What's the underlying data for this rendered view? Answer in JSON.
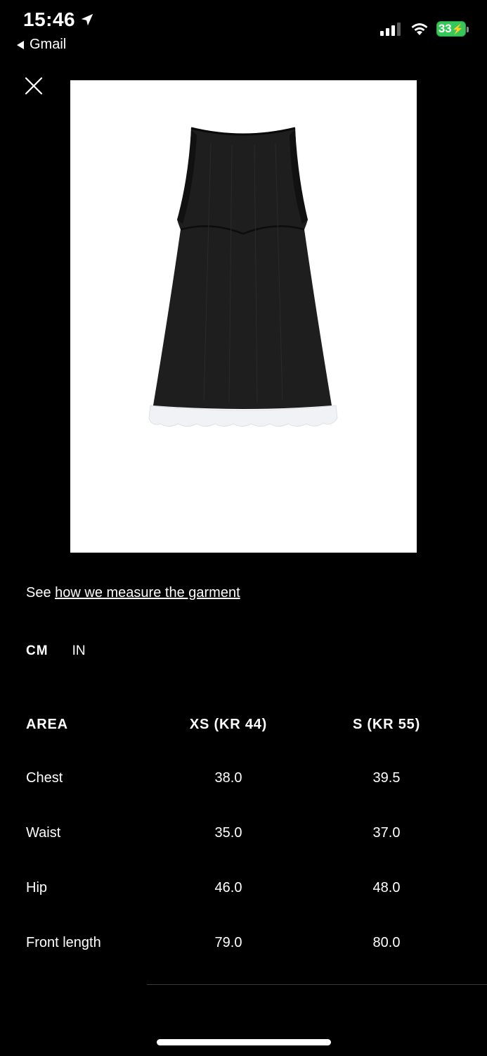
{
  "status_bar": {
    "time": "15:46",
    "back_app": "Gmail",
    "battery": "33"
  },
  "icons": {
    "location": "location-arrow-icon",
    "back": "back-triangle-icon",
    "signal": "cellular-signal-icon",
    "wifi": "wifi-icon",
    "battery": "battery-charging-icon",
    "close": "close-icon"
  },
  "product_image": {
    "description_name": "black sleeveless mini dress with white ruffle hem"
  },
  "measure": {
    "prefix": "See ",
    "link": "how we measure the garment"
  },
  "units": {
    "cm": "CM",
    "in": "IN",
    "selected": "CM"
  },
  "size_table": {
    "headers": [
      "AREA",
      "XS (KR 44)",
      "S (KR 55)"
    ],
    "rows": [
      {
        "area": "Chest",
        "xs": "38.0",
        "s": "39.5"
      },
      {
        "area": "Waist",
        "xs": "35.0",
        "s": "37.0"
      },
      {
        "area": "Hip",
        "xs": "46.0",
        "s": "48.0"
      },
      {
        "area": "Front length",
        "xs": "79.0",
        "s": "80.0"
      }
    ]
  },
  "colors": {
    "background": "#000000",
    "text": "#ffffff",
    "battery": "#35c759"
  }
}
